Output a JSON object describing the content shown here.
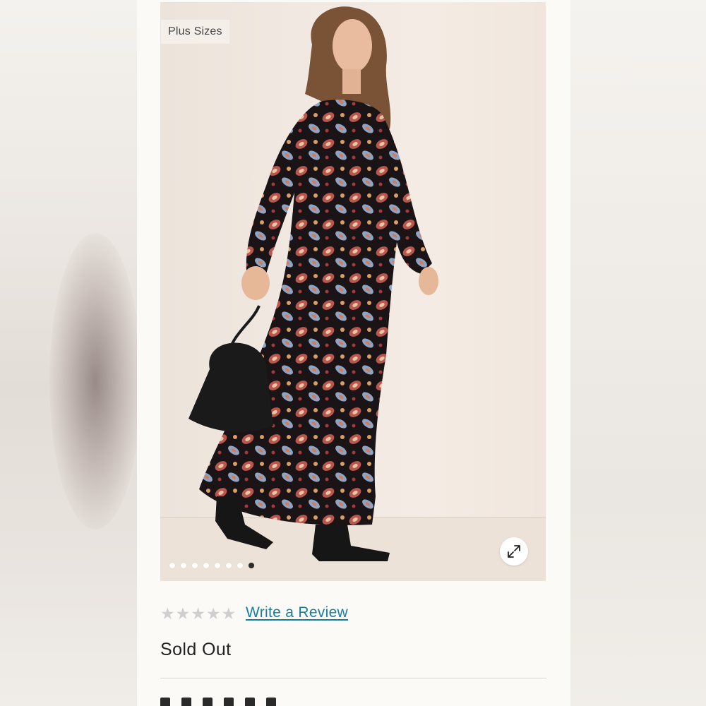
{
  "product_image": {
    "badge": "Plus Sizes",
    "expand_icon": "expand-arrows-icon",
    "dots_total": 8,
    "active_dot_index": 7
  },
  "rating": {
    "stars": 5,
    "filled": 0,
    "star_icon": "star-icon",
    "write_review_label": "Write a Review"
  },
  "availability": {
    "status": "Sold Out"
  },
  "colors": {
    "link": "#167fa0",
    "text": "#222222",
    "star_empty": "#cfcfcf",
    "panel_bg": "#fbfaf6"
  }
}
